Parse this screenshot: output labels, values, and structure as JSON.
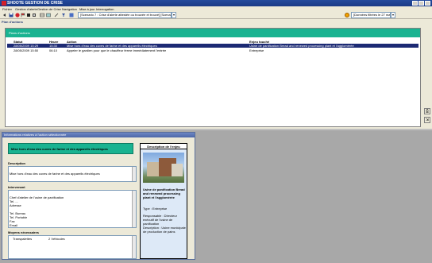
{
  "window": {
    "title": "SHOOTE GESTION DE CRISE"
  },
  "menu": [
    "Fichier",
    "Gestion d'alerte",
    "Gestion de Crise",
    "Navigation",
    "Mise à jour",
    "Interrogation"
  ],
  "toolbar": {
    "combo_text": "[Scenario 7 : Crise d'alerte attestée ou trouvée et trouvé] [Scenario choisi par l'utilisateur]",
    "status_text": "[Données filtrées le 27 mai]"
  },
  "actions_pane": {
    "title": "Plan d'actions",
    "header": "Plans d'actions",
    "columns": {
      "date": "Statut",
      "time": "Heure",
      "action": "Action",
      "target": "Enjeu touché"
    },
    "rows": [
      {
        "date": "28/05/2009 15:29",
        "time": "15:30",
        "action": "Mise hors d'eau des cuves de farine et des appareils électriques",
        "target": "Usine de panification Bread and renewed processing plant et l'agglomérée",
        "selected": true
      },
      {
        "date": "28/05/2009 15:50",
        "time": "06:10",
        "action": "Appeler le gardien pour que le chauffeur ferme immédiatement l'entrée",
        "target": "Entreprise",
        "selected": false
      }
    ]
  },
  "popup": {
    "title": "Informations relatives à l'action sélectionnée",
    "header": "Mise hors d'eau des cuves de farine et des appareils électriques",
    "description_label": "Description",
    "description_text": "Mise hors d'eau des cuves de farine et des appareils électriques",
    "contact_label": "Intervenant",
    "contact_text": "Chef d'atelier de l'usine de panification\nTel. ...\nAdresse\n\nTel. Bureau\nTel. Portable\nFax\nEmail",
    "means_label": "Moyens nécessaires",
    "means_col1": "Transpalettes",
    "means_col2": "2 Véhicules",
    "enjeu_title": "Description de l'enjeu",
    "enjeu_name": "Usine de panification Bread and renewed processing plant et l'agglomérée",
    "enjeu_type": "Type : Entreprise",
    "enjeu_resp": "Responsable : Directeur exécutif de l'usine de panification",
    "enjeu_desc": "Description : Usine municipale de production de pains"
  }
}
